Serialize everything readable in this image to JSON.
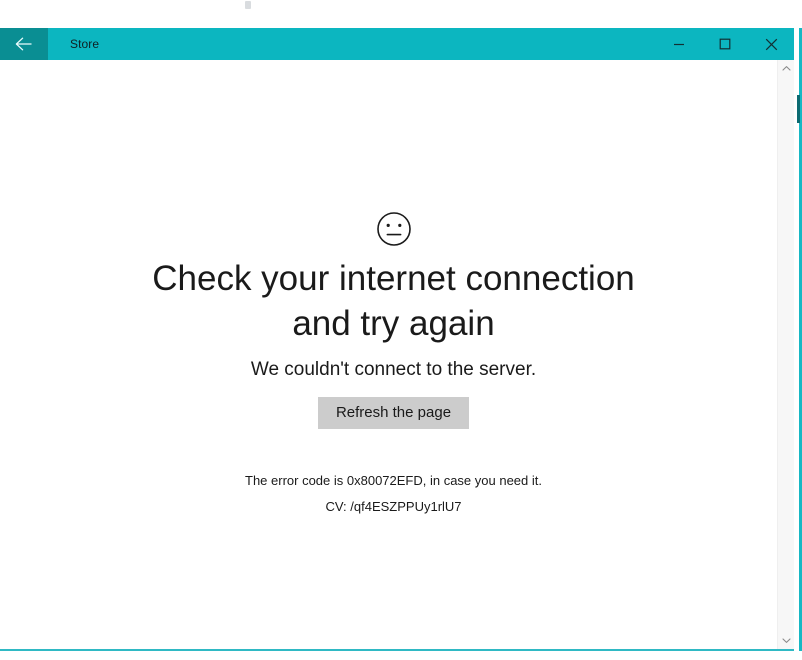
{
  "window": {
    "title": "Store",
    "back_icon": "back-arrow-icon",
    "controls": {
      "minimize_icon": "minimize-icon",
      "maximize_icon": "maximize-icon",
      "close_icon": "close-icon"
    },
    "colors": {
      "titlebar": "#0cb6c0",
      "back_button": "#0a8e93",
      "titlebar_text": "#0f2022",
      "window_border": "#2fb9c4",
      "button_face": "#cccccc",
      "body_text": "#1a1a1a"
    }
  },
  "error_page": {
    "face_icon": "neutral-face-icon",
    "headline": "Check your internet connection and try again",
    "subhead": "We couldn't connect to the server.",
    "refresh_label": "Refresh the page",
    "error_code_text": "The error code is 0x80072EFD, in case you need it.",
    "error_code": "0x80072EFD",
    "correlation_vector_text": "CV: /qf4ESZPPUy1rlU7",
    "correlation_vector": "/qf4ESZPPUy1rlU7"
  },
  "scrollbar": {
    "up_icon": "chevron-up-icon",
    "down_icon": "chevron-down-icon"
  }
}
